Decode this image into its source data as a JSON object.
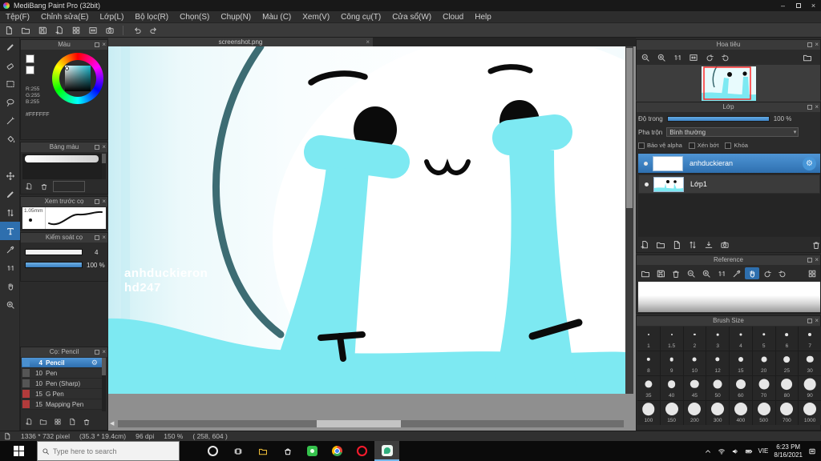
{
  "window": {
    "title": "MediBang Paint Pro (32bit)",
    "menu": [
      "Tệp(F)",
      "Chỉnh sửa(E)",
      "Lớp(L)",
      "Bộ lọc(R)",
      "Chọn(S)",
      "Chụp(N)",
      "Màu (C)",
      "Xem(V)",
      "Công cụ(T)",
      "Cửa sổ(W)",
      "Cloud",
      "Help"
    ]
  },
  "canvas": {
    "tab": "screenshot.png",
    "watermark_line1": "anhduckieron",
    "watermark_line2": "hd247"
  },
  "left_panels": {
    "color": {
      "title": "Màu",
      "r": "R:255",
      "g": "G:255",
      "b": "B:255",
      "hex": "#FFFFFF"
    },
    "palette": {
      "title": "Bảng màu"
    },
    "brush_preview": {
      "title": "Xem trước cọ",
      "size": "1.05mm"
    },
    "brush_control": {
      "title": "Kiểm soát cọ",
      "size_value": "4",
      "opacity_value": "100 %"
    },
    "brush_list": {
      "title": "Cọ: Pencil",
      "brushes": [
        {
          "size": "4",
          "name": "Pencil"
        },
        {
          "size": "10",
          "name": "Pen"
        },
        {
          "size": "10",
          "name": "Pen (Sharp)"
        },
        {
          "size": "15",
          "name": "G Pen"
        },
        {
          "size": "15",
          "name": "Mapping Pen"
        }
      ]
    }
  },
  "right_panels": {
    "navigator": {
      "title": "Hoa tiêu"
    },
    "layer": {
      "title": "Lớp",
      "opacity_label": "Độ trong",
      "opacity_value": "100 %",
      "blend_label": "Pha trộn",
      "blend_value": "Bình thường",
      "protect_alpha": "Bảo vệ alpha",
      "clipping": "Xén bớt",
      "lock": "Khóa",
      "layers": [
        {
          "name": "anhduckieran"
        },
        {
          "name": "Lớp1"
        }
      ]
    },
    "reference": {
      "title": "Reference"
    },
    "brush_size": {
      "title": "Brush Size",
      "sizes": [
        "1",
        "1.5",
        "2",
        "3",
        "4",
        "5",
        "6",
        "7",
        "8",
        "9",
        "10",
        "12",
        "15",
        "20",
        "25",
        "30",
        "35",
        "40",
        "45",
        "50",
        "60",
        "70",
        "80",
        "90",
        "100",
        "150",
        "200",
        "300",
        "400",
        "500",
        "700",
        "1000"
      ]
    }
  },
  "status_bar": {
    "dimensions": "1336 * 732 pixel",
    "physical": "(35.3 * 19.4cm)",
    "dpi": "96 dpi",
    "zoom": "150 %",
    "coords": "( 258, 604 )"
  },
  "taskbar": {
    "search_placeholder": "Type here to search",
    "language": "VIE",
    "time": "6:23 PM",
    "date": "8/16/2021"
  },
  "colors": {
    "accent_blue": "#3f88c5",
    "canvas_cyan": "#7de9f2",
    "canvas_dark_teal": "#33646b",
    "selected_brush_red": "#b23b3b",
    "white": "#ffffff"
  }
}
